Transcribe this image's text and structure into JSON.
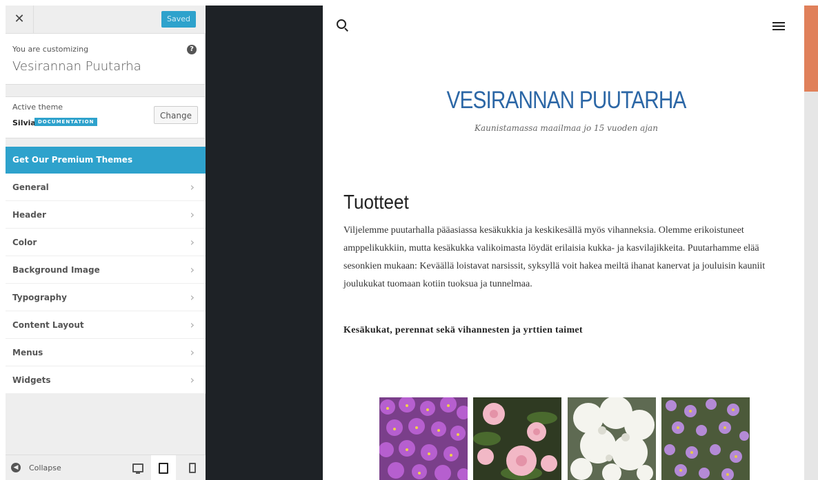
{
  "topbar": {
    "close_glyph": "✕",
    "saved_label": "Saved"
  },
  "info": {
    "customizing_label": "You are customizing",
    "site_name": "Vesirannan Puutarha",
    "help_glyph": "?"
  },
  "theme": {
    "label": "Active theme",
    "name": "Silvia",
    "badge": "DOCUMENTATION",
    "change_label": "Change"
  },
  "premium_label": "Get Our Premium Themes",
  "menu": {
    "items": [
      {
        "label": "General"
      },
      {
        "label": "Header"
      },
      {
        "label": "Color"
      },
      {
        "label": "Background Image"
      },
      {
        "label": "Typography"
      },
      {
        "label": "Content Layout"
      },
      {
        "label": "Menus"
      },
      {
        "label": "Widgets"
      }
    ],
    "chevron": "›"
  },
  "bottom": {
    "collapse_label": "Collapse",
    "collapse_glyph": "◀"
  },
  "preview": {
    "site_title": "VESIRANNAN PUUTARHA",
    "tagline": "Kaunistamassa maailmaa jo 15 vuoden ajan",
    "heading": "Tuotteet",
    "body": "Viljelemme puutarhalla pääasiassa kesäkukkia ja keskikesällä myös vihanneksia. Olemme erikoistuneet amppelikukkiin, mutta kesäkukka valikoimasta löydät erilaisia kukka- ja kasvilajikkeita. Puutarhamme elää sesonkien mukaan: Keväällä loistavat narsissit, syksyllä voit hakea meiltä ihanat kanervat ja jouluisin kauniit joulukukat tuomaan kotiin tuoksua ja tunnelmaa.",
    "subheading": "Kesäkukat, perennat sekä vihannesten ja yrttien taimet"
  },
  "colors": {
    "accent": "#2ea2cc",
    "title": "#2c67a6",
    "scroll_thumb": "#e0805a",
    "backdrop": "#1e2226"
  }
}
